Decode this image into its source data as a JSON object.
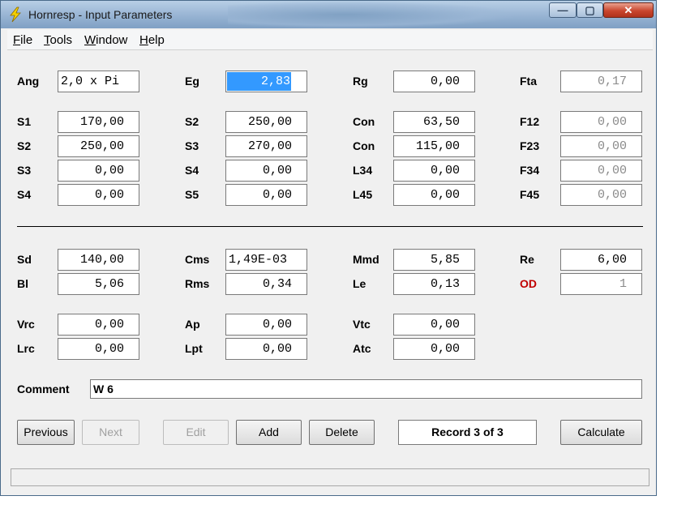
{
  "window": {
    "title": "Hornresp - Input Parameters"
  },
  "titlebar": {
    "min": "—",
    "max": "▢",
    "close": "✕"
  },
  "menu": {
    "file": "File",
    "tools": "Tools",
    "window": "Window",
    "help": "Help"
  },
  "rows": {
    "ang": {
      "label": "Ang",
      "value": "2,0 x Pi"
    },
    "eg": {
      "label": "Eg",
      "value": "2,83"
    },
    "rg": {
      "label": "Rg",
      "value": "0,00"
    },
    "fta": {
      "label": "Fta",
      "value": "0,17"
    },
    "s1": {
      "label": "S1",
      "value": "170,00"
    },
    "s2a": {
      "label": "S2",
      "value": "250,00"
    },
    "con1": {
      "label": "Con",
      "value": "63,50"
    },
    "f12": {
      "label": "F12",
      "value": "0,00"
    },
    "s2b": {
      "label": "S2",
      "value": "250,00"
    },
    "s3a": {
      "label": "S3",
      "value": "270,00"
    },
    "con2": {
      "label": "Con",
      "value": "115,00"
    },
    "f23": {
      "label": "F23",
      "value": "0,00"
    },
    "s3b": {
      "label": "S3",
      "value": "0,00"
    },
    "s4a": {
      "label": "S4",
      "value": "0,00"
    },
    "l34": {
      "label": "L34",
      "value": "0,00"
    },
    "f34": {
      "label": "F34",
      "value": "0,00"
    },
    "s4b": {
      "label": "S4",
      "value": "0,00"
    },
    "s5": {
      "label": "S5",
      "value": "0,00"
    },
    "l45": {
      "label": "L45",
      "value": "0,00"
    },
    "f45": {
      "label": "F45",
      "value": "0,00"
    },
    "sd": {
      "label": "Sd",
      "value": "140,00"
    },
    "cms": {
      "label": "Cms",
      "value": "1,49E-03"
    },
    "mmd": {
      "label": "Mmd",
      "value": "5,85"
    },
    "re": {
      "label": "Re",
      "value": "6,00"
    },
    "bl": {
      "label": "Bl",
      "value": "5,06"
    },
    "rms": {
      "label": "Rms",
      "value": "0,34"
    },
    "le": {
      "label": "Le",
      "value": "0,13"
    },
    "od": {
      "label": "OD",
      "value": "1"
    },
    "vrc": {
      "label": "Vrc",
      "value": "0,00"
    },
    "ap": {
      "label": "Ap",
      "value": "0,00"
    },
    "vtc": {
      "label": "Vtc",
      "value": "0,00"
    },
    "lrc": {
      "label": "Lrc",
      "value": "0,00"
    },
    "lpt": {
      "label": "Lpt",
      "value": "0,00"
    },
    "atc": {
      "label": "Atc",
      "value": "0,00"
    }
  },
  "comment": {
    "label": "Comment",
    "value": "W 6"
  },
  "buttons": {
    "previous": "Previous",
    "next": "Next",
    "edit": "Edit",
    "add": "Add",
    "delete": "Delete",
    "calculate": "Calculate"
  },
  "record": "Record 3 of 3",
  "colors": {
    "selection": "#3399ff",
    "od_label": "#c00000"
  }
}
